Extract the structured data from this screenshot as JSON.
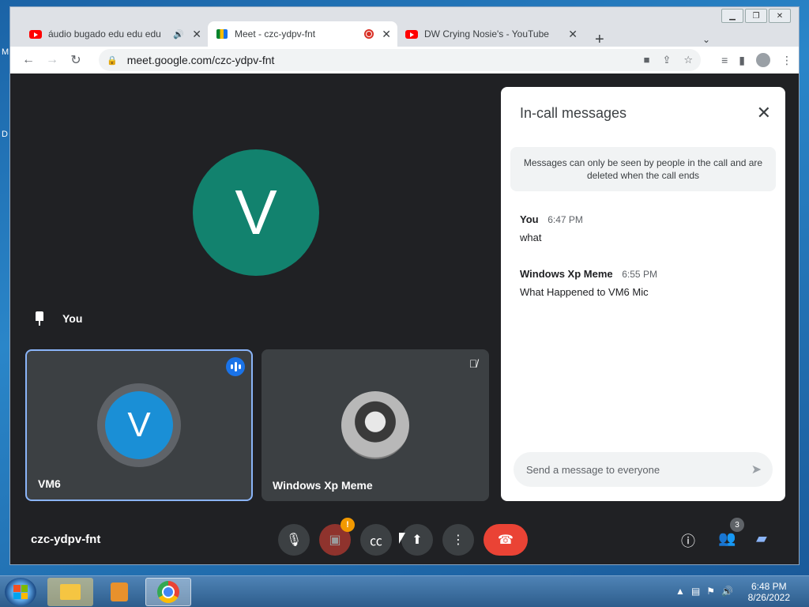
{
  "desktop": {
    "frag1": "M",
    "frag2": "D"
  },
  "tabs": [
    {
      "title": "áudio bugado edu edu edu"
    },
    {
      "title": "Meet - czc-ydpv-fnt"
    },
    {
      "title": "DW Crying Nosie's - YouTube"
    }
  ],
  "address_bar": {
    "url": "meet.google.com/czc-ydpv-fnt"
  },
  "meet": {
    "pinned_label": "You",
    "big_avatar_letter": "V",
    "participants": [
      {
        "name": "VM6",
        "avatar_letter": "V"
      },
      {
        "name": "Windows Xp Meme"
      }
    ],
    "meeting_code": "czc-ydpv-fnt",
    "people_count": "3",
    "camera_warning": "!"
  },
  "chat": {
    "title": "In-call messages",
    "notice": "Messages can only be seen by people in the call and are deleted when the call ends",
    "messages": [
      {
        "sender": "You",
        "time": "6:47 PM",
        "text": "what"
      },
      {
        "sender": "Windows Xp Meme",
        "time": "6:55 PM",
        "text": "What Happened to VM6 Mic"
      }
    ],
    "input_placeholder": "Send a message to everyone"
  },
  "taskbar": {
    "time": "6:48 PM",
    "date": "8/26/2022"
  },
  "colors": {
    "meet_bg": "#202124",
    "tile_bg": "#3c4043",
    "end_call": "#ea4335",
    "accent": "#1a73e8",
    "avatar_main": "#12826e"
  }
}
